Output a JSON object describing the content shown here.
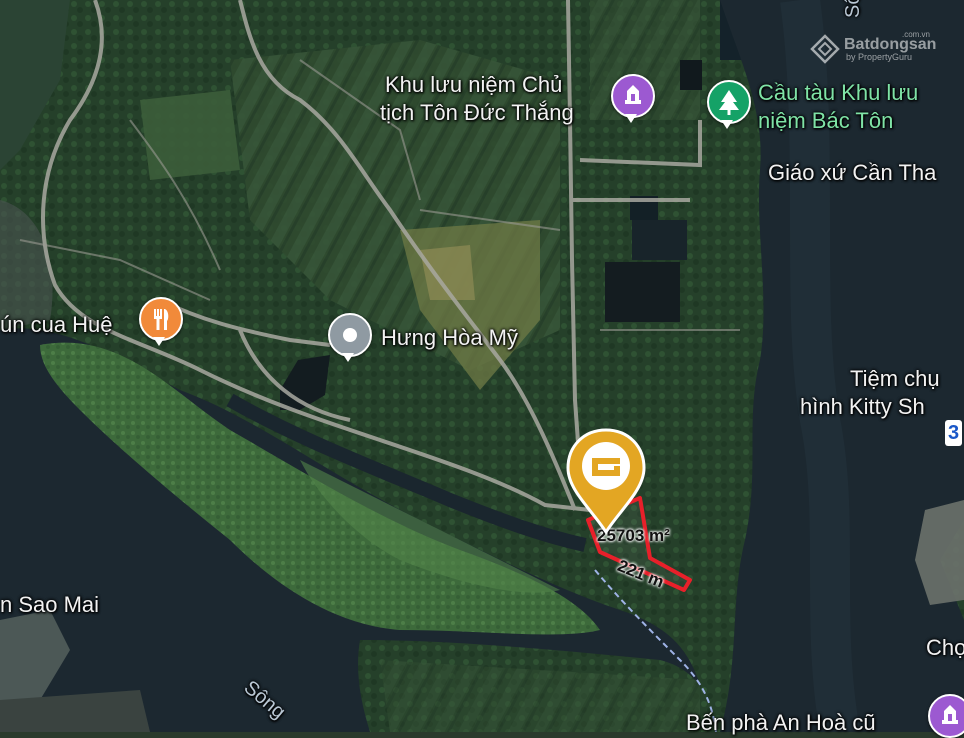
{
  "watermark": {
    "brand": "Batdongsan",
    "by": "by PropertyGuru",
    "tld": ".com.vn"
  },
  "labels": {
    "song_top": "Sông",
    "khu_luu_niem_line1": "Khu lưu niệm Chủ",
    "khu_luu_niem_line2": "tịch Tôn Đức Thắng",
    "cau_tau_line1": "Cầu tàu Khu lưu",
    "cau_tau_line2": "niệm Bác Tôn",
    "giao_xu": "Giáo xứ Cần Tha",
    "bun_cua_hue": "ún cua Huệ",
    "hung_hoa_my": "Hưng Hòa Mỹ",
    "tiem_chup_line1": "Tiệm chụ",
    "tiem_chup_line2": "hình Kitty Sh",
    "route_badge": "3",
    "sao_mai": "n Sao Mai",
    "cho": "Chợ",
    "song_bottom": "Sông",
    "ben_pha": "Bến phà An Hoà cũ"
  },
  "parcel": {
    "area_label": "25703 m²",
    "length_label": "221 m",
    "border_color": "#e8202a",
    "marker_color": "#e3a623"
  },
  "icons": {
    "memorial": "monument-icon",
    "pier": "tree-icon",
    "restaurant": "fork-knife-icon",
    "place": "location-dot-icon",
    "ferry": "monument-icon",
    "logo": "batdongsan-logo-icon",
    "marker": "property-marker-icon"
  },
  "colors": {
    "purple": "#9c59d1",
    "green": "#15a267",
    "orange": "#f18a3a",
    "gray": "#8f9aa2"
  }
}
